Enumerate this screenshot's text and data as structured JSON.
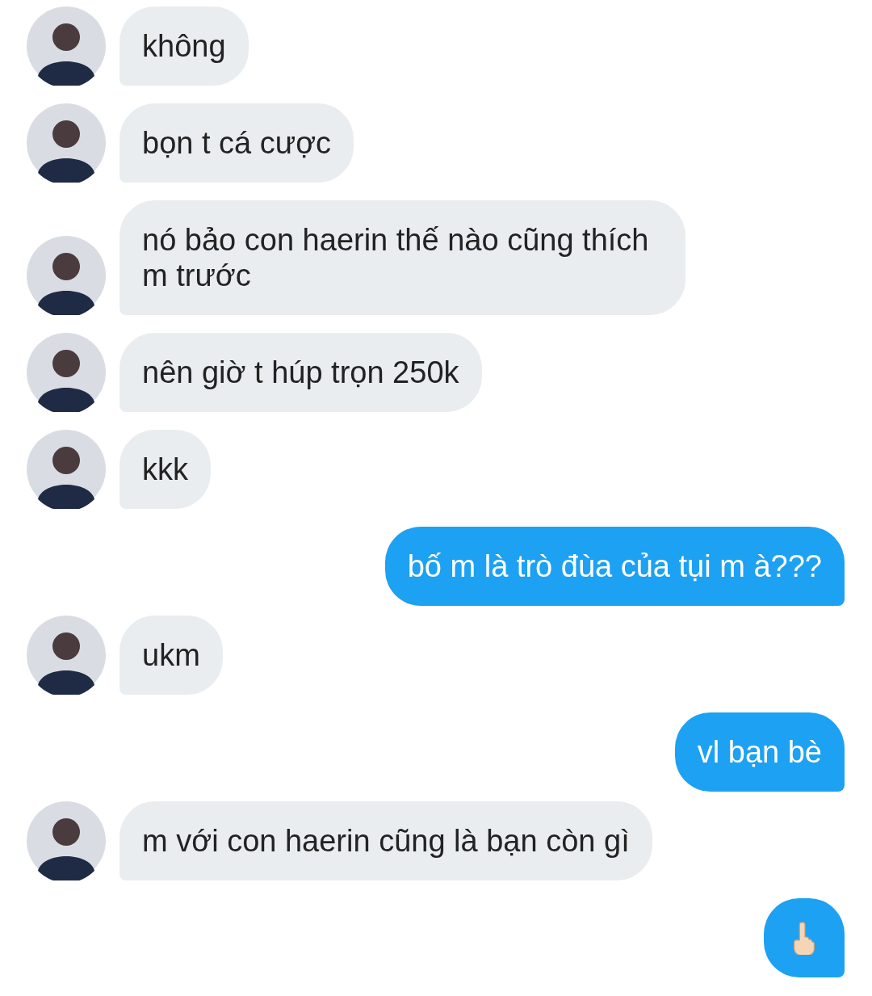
{
  "messages": [
    {
      "outgoing": false,
      "kind": "text",
      "text": "không"
    },
    {
      "outgoing": false,
      "kind": "text",
      "text": "bọn t cá cược"
    },
    {
      "outgoing": false,
      "kind": "text",
      "text": "nó bảo con haerin thế nào cũng thích m trước"
    },
    {
      "outgoing": false,
      "kind": "text",
      "text": "nên giờ t húp trọn 250k"
    },
    {
      "outgoing": false,
      "kind": "text",
      "text": "kkk"
    },
    {
      "outgoing": true,
      "kind": "text",
      "text": "bố m là trò đùa của tụi m à???"
    },
    {
      "outgoing": false,
      "kind": "text",
      "text": "ukm"
    },
    {
      "outgoing": true,
      "kind": "text",
      "text": "vl bạn bè"
    },
    {
      "outgoing": false,
      "kind": "text",
      "text": "m với con haerin cũng là bạn còn gì"
    },
    {
      "outgoing": true,
      "kind": "gesture"
    }
  ]
}
